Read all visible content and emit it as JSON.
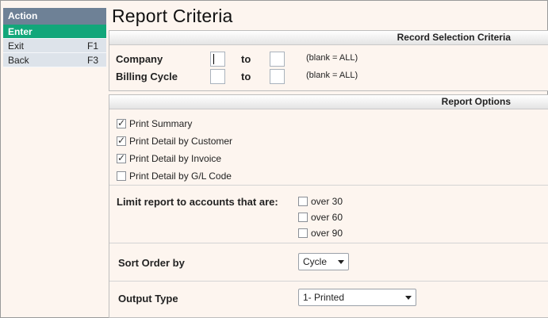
{
  "sidebar": {
    "header": "Action",
    "items": [
      {
        "label": "Enter",
        "key": ""
      },
      {
        "label": "Exit",
        "key": "F1"
      },
      {
        "label": "Back",
        "key": "F3"
      }
    ]
  },
  "title": "Report Criteria",
  "record_selection": {
    "header": "Record Selection Criteria",
    "rows": [
      {
        "label": "Company",
        "to": "to",
        "hint": "(blank = ALL)",
        "from_value": "",
        "to_value": ""
      },
      {
        "label": "Billing Cycle",
        "to": "to",
        "hint": "(blank = ALL)",
        "from_value": "",
        "to_value": ""
      }
    ]
  },
  "report_options": {
    "header": "Report Options",
    "print_options": [
      {
        "label": "Print Summary",
        "checked": true
      },
      {
        "label": "Print Detail by Customer",
        "checked": true
      },
      {
        "label": "Print Detail by Invoice",
        "checked": true
      },
      {
        "label": "Print Detail by G/L Code",
        "checked": false
      }
    ],
    "limit_label": "Limit report to accounts that are:",
    "limit_options": [
      {
        "label": "over 30",
        "checked": false
      },
      {
        "label": "over 60",
        "checked": false
      },
      {
        "label": "over 90",
        "checked": false
      }
    ],
    "sort_label": "Sort Order by",
    "sort_value": "Cycle",
    "output_label": "Output Type",
    "output_value": "1- Printed"
  }
}
